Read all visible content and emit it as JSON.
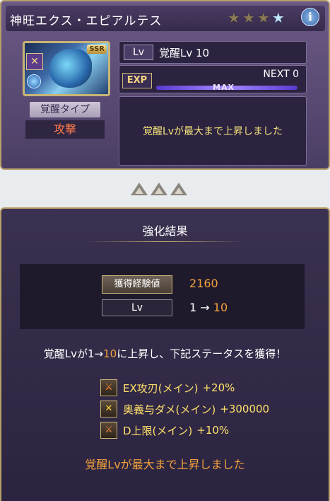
{
  "character": {
    "name": "神旺エクス・エピアルテス",
    "stars_total": 4,
    "stars_lit": 1,
    "rarity": "SSR",
    "type_label": "覚醒タイプ",
    "type_value": "攻撃"
  },
  "level": {
    "tag": "Lv",
    "text": "覚醒Lv 10"
  },
  "exp": {
    "tag": "EXP",
    "next": "NEXT 0",
    "bar_label": "MAX",
    "fill_fraction": 1.0
  },
  "top_message": "覚醒Lvが最大まで上昇しました",
  "result": {
    "title": "強化結果",
    "exp_label": "獲得経験値",
    "exp_value": "2160",
    "lv_label": "Lv",
    "lv_from": "1",
    "lv_arrow": "→",
    "lv_to": "10",
    "summary_prefix": "覚醒Lvが1→",
    "summary_to": "10",
    "summary_suffix": "に上昇し、下記ステータスを獲得！",
    "bonuses": [
      {
        "name": "EX攻刃(メイン)",
        "value": "+20%",
        "icon": "sword-up-icon"
      },
      {
        "name": "奥義与ダメ(メイン)",
        "value": "+300000",
        "icon": "crossed-swords-icon"
      },
      {
        "name": "D上限(メイン)",
        "value": "+10%",
        "icon": "sword-up-icon"
      }
    ],
    "final_message": "覚醒Lvが最大まで上昇しました"
  }
}
